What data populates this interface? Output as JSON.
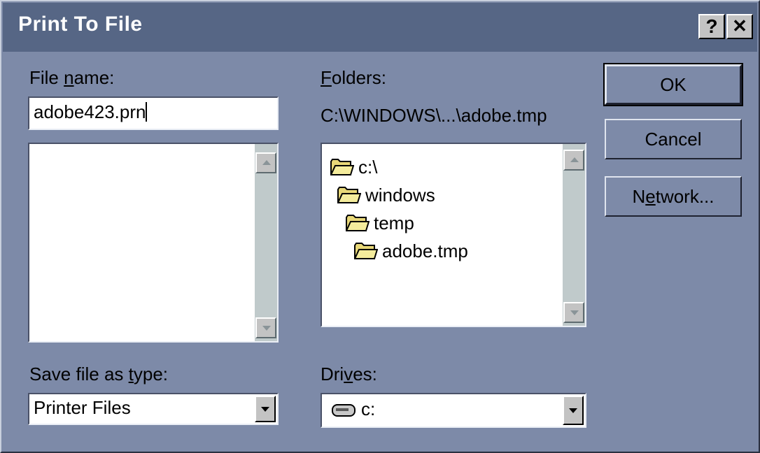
{
  "window": {
    "title": "Print To File",
    "help_button": "?",
    "close_button": "✕"
  },
  "file_name": {
    "label": "File name:",
    "label_pre": "File ",
    "label_ul": "n",
    "label_post": "ame:",
    "value": "adobe423.prn",
    "files": []
  },
  "folders": {
    "label": "Folders:",
    "label_ul": "F",
    "label_post": "olders:",
    "current_path": "C:\\WINDOWS\\...\\adobe.tmp",
    "items": [
      {
        "label": "c:\\",
        "icon": "open-folder-icon"
      },
      {
        "label": "windows",
        "icon": "open-folder-icon"
      },
      {
        "label": "temp",
        "icon": "open-folder-icon"
      },
      {
        "label": "adobe.tmp",
        "icon": "open-folder-icon"
      }
    ]
  },
  "save_as_type": {
    "label": "Save file as type:",
    "label_pre": "Save file as ",
    "label_ul": "t",
    "label_post": "ype:",
    "selected": "Printer Files"
  },
  "drives": {
    "label": "Drives:",
    "label_pre": "Dri",
    "label_ul": "v",
    "label_post": "es:",
    "selected": "c:",
    "icon": "hard-drive-icon"
  },
  "buttons": {
    "ok": "OK",
    "cancel": "Cancel",
    "network": "Network...",
    "network_pre": "N",
    "network_ul": "e",
    "network_post": "twork..."
  },
  "colors": {
    "dialog_bg": "#7d8aa8",
    "titlebar": "#566685",
    "folder_yellow": "#e8d878"
  }
}
